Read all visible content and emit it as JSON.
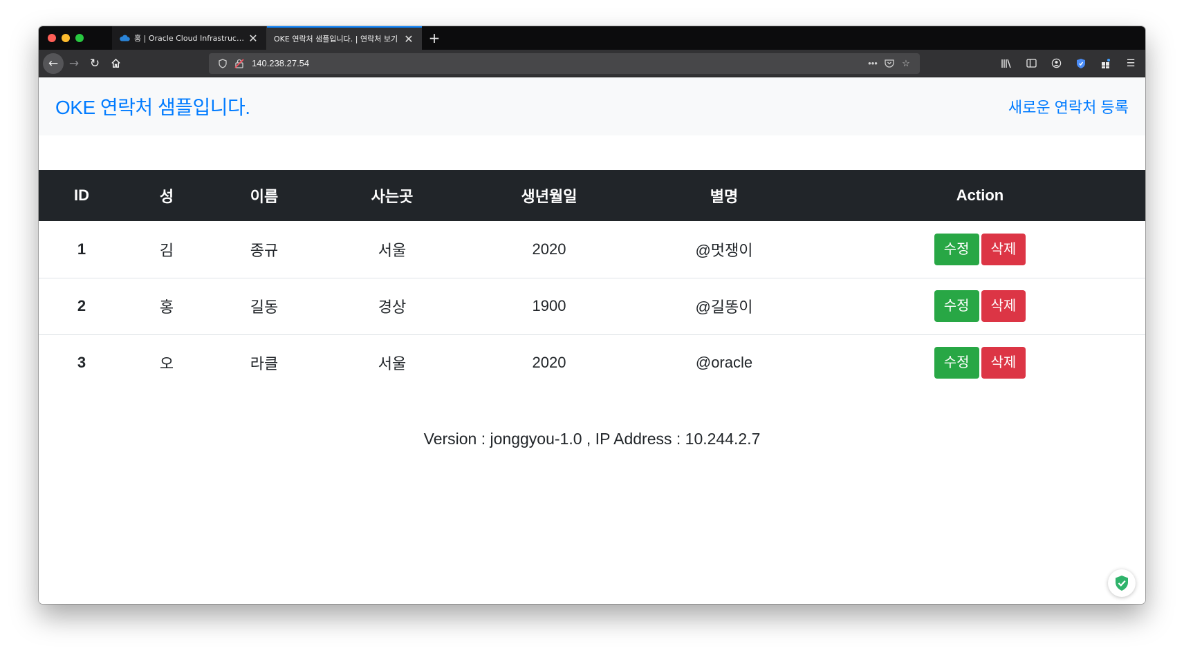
{
  "browser": {
    "tabs": [
      {
        "title": "홍 | Oracle Cloud Infrastructure",
        "active": false
      },
      {
        "title": "OKE 연락처 샘플입니다. | 연락처 보기",
        "active": true
      }
    ],
    "url": "140.238.27.54",
    "colors": {
      "tab_accent": "#0a84ff",
      "chrome_dark": "#0c0c0d",
      "toolbar": "#323234"
    }
  },
  "header": {
    "brand": "OKE 연락처 샘플입니다.",
    "add_link": "새로운 연락처 등록"
  },
  "table": {
    "columns": [
      "ID",
      "성",
      "이름",
      "사는곳",
      "생년월일",
      "별명",
      "Action"
    ],
    "rows": [
      {
        "id": "1",
        "last": "김",
        "first": "종규",
        "city": "서울",
        "birth": "2020",
        "nick": "@멋쟁이"
      },
      {
        "id": "2",
        "last": "홍",
        "first": "길동",
        "city": "경상",
        "birth": "1900",
        "nick": "@길똥이"
      },
      {
        "id": "3",
        "last": "오",
        "first": "라클",
        "city": "서울",
        "birth": "2020",
        "nick": "@oracle"
      }
    ],
    "edit_label": "수정",
    "delete_label": "삭제"
  },
  "footer": {
    "version_text": "Version : jonggyou-1.0 , IP Address : 10.244.2.7"
  },
  "colors": {
    "brand": "#007bff",
    "header_bg": "#f8f9fa",
    "table_head": "#212529",
    "success": "#28a745",
    "danger": "#dc3545"
  }
}
